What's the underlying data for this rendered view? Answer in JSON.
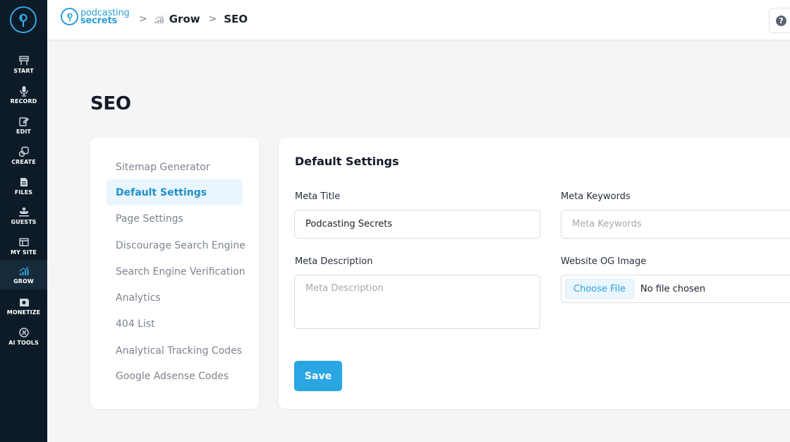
{
  "sidebar": {
    "items": [
      {
        "label": "START",
        "icon": "start-icon"
      },
      {
        "label": "RECORD",
        "icon": "microphone-icon"
      },
      {
        "label": "EDIT",
        "icon": "edit-icon"
      },
      {
        "label": "CREATE",
        "icon": "create-icon"
      },
      {
        "label": "FILES",
        "icon": "files-icon"
      },
      {
        "label": "GUESTS",
        "icon": "guests-icon"
      },
      {
        "label": "MY SITE",
        "icon": "my-site-icon"
      },
      {
        "label": "GROW",
        "icon": "grow-icon",
        "active": true
      },
      {
        "label": "MONETIZE",
        "icon": "monetize-icon"
      },
      {
        "label": "AI TOOLS",
        "icon": "ai-tools-icon"
      }
    ]
  },
  "topbar": {
    "brand_line1": "podcasting",
    "brand_line2": "secrets",
    "breadcrumbs": [
      "Grow",
      "SEO"
    ],
    "separator": ">"
  },
  "page": {
    "title": "SEO"
  },
  "menu": {
    "items": [
      "Sitemap Generator",
      "Default Settings",
      "Page Settings",
      "Discourage Search Engine",
      "Search Engine Verification",
      "Analytics",
      "404 List",
      "Analytical Tracking Codes",
      "Google Adsense Codes"
    ],
    "active_index": 1
  },
  "form": {
    "title": "Default Settings",
    "meta_title_label": "Meta Title",
    "meta_title_value": "Podcasting Secrets",
    "meta_keywords_label": "Meta Keywords",
    "meta_keywords_placeholder": "Meta Keywords",
    "meta_description_label": "Meta Description",
    "meta_description_placeholder": "Meta Description",
    "og_image_label": "Website OG Image",
    "choose_file_label": "Choose File",
    "file_status": "No file chosen",
    "save_label": "Save"
  },
  "colors": {
    "sidebar_bg": "#0d1b28",
    "accent": "#2aa6e3",
    "active_menu_bg": "#eaf6fd",
    "page_bg": "#f4f5f7"
  }
}
